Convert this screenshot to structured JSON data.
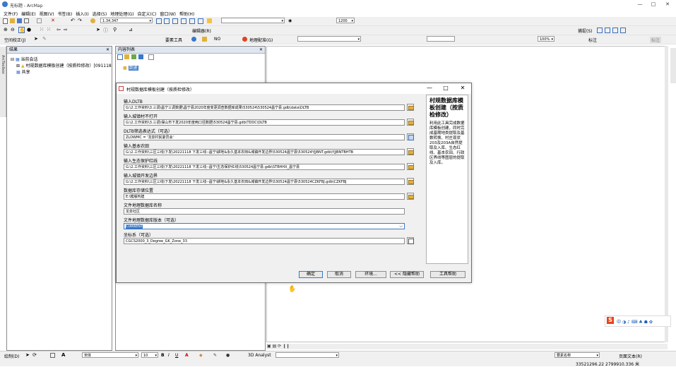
{
  "app": {
    "title": "无标题 - ArcMap"
  },
  "menu": [
    "文件(F)",
    "编辑(E)",
    "视图(V)",
    "书签(B)",
    "插入(I)",
    "选择(S)",
    "地理处理(G)",
    "自定义(C)",
    "窗口(W)",
    "帮助(H)"
  ],
  "toolbar": {
    "scale": "1:34,347",
    "zoom": "1200",
    "georef_label": "地理配准(G)",
    "label_tool": "标注",
    "editor_label": "编辑器(R)",
    "spatial_adjust": "空间校正(J)",
    "snap_label": "捕捉(S)",
    "layers_combo": "",
    "survey_label": "要素工具",
    "ratio": "100%",
    "overlay_label": "标注"
  },
  "toc": {
    "title": "结果",
    "items": [
      {
        "label": "当前会话"
      },
      {
        "label": "村规数据库模板创建（按质检修改）[091118"
      },
      {
        "label": "共享"
      }
    ]
  },
  "catalog": {
    "title": "内容列表",
    "items": [
      {
        "label": "数据"
      }
    ]
  },
  "side_tabs": [
    "ArcToolbox"
  ],
  "dialog": {
    "title": "村规数据库模板创建（按质检修改）",
    "fields": [
      {
        "label": "输入DLTB",
        "value": "G:\\2.工作资料\\3.三调\\昌宁三调数据\\昌宁县2020年度变更调查数据库成果\\530524\\530524昌宁县.gdb\\data\\DLTB",
        "button": "folder"
      },
      {
        "label": "输入城镇村不打开",
        "value": "G:\\2.工作资料\\3.三调\\保山市下发2020年度两口径数据\\530524昌宁县.gdb\\TDDC\\DLTB",
        "button": "folder"
      },
      {
        "label": "DLTB筛选表达式（可选）",
        "value": "ZLDWMC = '龙泉村民委员会'",
        "button": "sql"
      },
      {
        "label": "输入基本农田",
        "value": "G:\\2.工作资料\\三区三线\\下发\\20221118 下发三线--昌宁\\耕地&永久基本农田&城镇开发边界\\530524昌宁县\\530524YJJBNT.gdb\\YJJBNTBHTB",
        "button": "folder"
      },
      {
        "label": "输入生态保护红线",
        "value": "G:\\2.工作资料\\三区三线\\下发\\20221118 下发三线--昌宁\\生态保护红线\\530524昌宁县.gdb\\STBHHX_昌宁县",
        "button": "folder"
      },
      {
        "label": "输入城镇开发边界",
        "value": "G:\\2.工作资料\\三区三线\\下发\\20221118 下发三线--昌宁\\耕地&永久基本农田&城镇开发边界\\530524昌宁县\\530524CZKFBJ.gdb\\CZKFBJ",
        "button": "folder"
      },
      {
        "label": "数据库存储位置",
        "value": "E:\\模版构建",
        "button": "folder"
      },
      {
        "label": "文件地理数据库名称",
        "value": "龙泉社区",
        "button": "none"
      },
      {
        "label": "文件地理数据库版本（可选）",
        "value": "CURRENT",
        "button": "combo"
      },
      {
        "label": "坐标系（可选）",
        "value": "CGCS2000_3_Degree_GK_Zone_33",
        "button": "coord"
      }
    ],
    "buttons": {
      "ok": "确定",
      "cancel": "取消",
      "env": "环境...",
      "hide_help": "<< 隐藏帮助",
      "tool_help": "工具帮助"
    },
    "help": {
      "title": "村规数据库模板创建（按质检修改）",
      "body": "利用此工具完成数据库模板创建，同时完成基期地类提取及基数转换、村庄现状203及203A自然提取及入库、生态红线、基本农田、行政区界线等图层的提取及入库。"
    }
  },
  "drawbar": {
    "draw_label": "绘制(D)",
    "font": "宋体",
    "size": "10",
    "analyst": "3D Analyst",
    "name_label": "要素名称",
    "layout_label": "页面文本(R)"
  },
  "status": {
    "coords": "33521296.22  2799910.336 米"
  }
}
